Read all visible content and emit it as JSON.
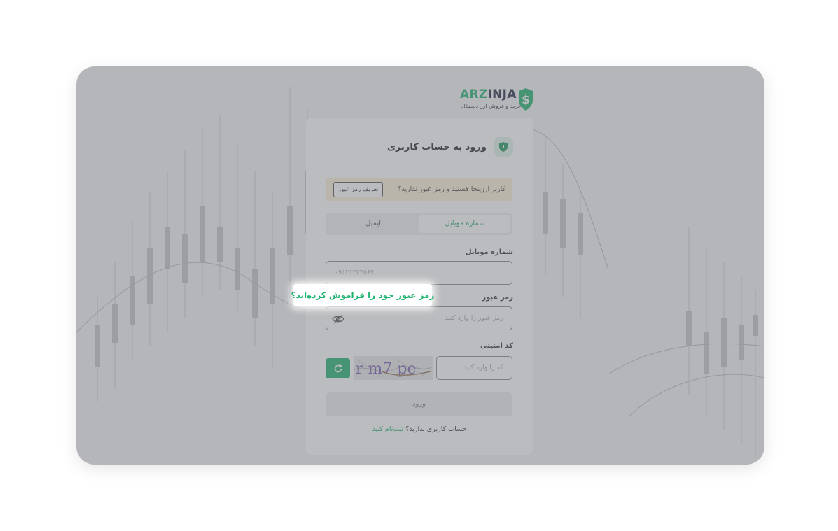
{
  "brand": {
    "name_part1": "ARZ",
    "name_part2": "INJA",
    "tagline": "خرید و فروش ارز دیجیتال",
    "color_primary": "#20b36f",
    "color_dark": "#1f2a44"
  },
  "login": {
    "title": "ورود به حساب کاربری",
    "title_icon": "shield-icon",
    "notice_text": "کاربر ارزینجا هستید و رمز عبور ندارید؟",
    "notice_button": "تعریف رمز عبور",
    "tabs": [
      {
        "label": "شماره موبایل",
        "active": true
      },
      {
        "label": "ایمیل",
        "active": false
      }
    ],
    "mobile_label": "شماره موبایل",
    "mobile_placeholder": "۰۹۱۲۱۲۳۴۵۶۷",
    "password_label": "رمز عبور",
    "password_placeholder": "رمز عبور را وارد کنید",
    "password_toggle_icon": "eye-off-icon",
    "captcha_label": "کد امنیتی",
    "captcha_placeholder": "کد را وارد کنید",
    "captcha_text": "r m7 pe",
    "refresh_icon": "refresh-icon",
    "submit_label": "ورود",
    "signup_prompt": "حساب کاربری ندارید؟",
    "signup_link": "ثبت‌نام کنید"
  },
  "highlight": {
    "forgot_password": "رمز عبور خود را فراموش کرده‌اید؟"
  }
}
